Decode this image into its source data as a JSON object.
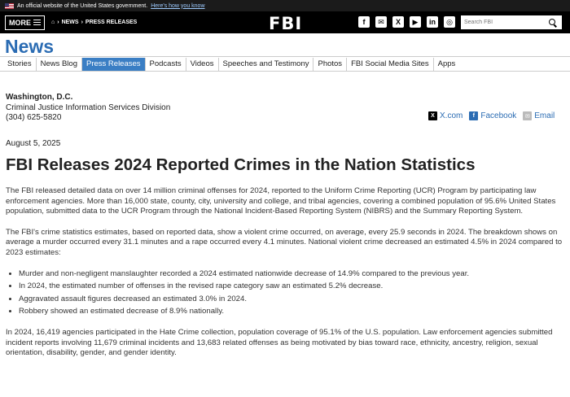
{
  "gov_banner": {
    "text": "An official website of the United States government.",
    "link": "Here's how you know"
  },
  "header": {
    "more_label": "MORE",
    "breadcrumb": [
      "NEWS",
      "PRESS RELEASES"
    ],
    "logo": "FBI",
    "social_icons": [
      "facebook-icon",
      "email-icon",
      "x-icon",
      "youtube-icon",
      "linkedin-icon",
      "instagram-icon"
    ],
    "search_placeholder": "Search FBI"
  },
  "section_title": "News",
  "subnav": [
    "Stories",
    "News Blog",
    "Press Releases",
    "Podcasts",
    "Videos",
    "Speeches and Testimony",
    "Photos",
    "FBI Social Media Sites",
    "Apps"
  ],
  "active_subnav": "Press Releases",
  "contact": {
    "city": "Washington, D.C.",
    "division": "Criminal Justice Information Services Division",
    "phone": "(304) 625-5820"
  },
  "share": {
    "x": "X.com",
    "facebook": "Facebook",
    "email": "Email"
  },
  "article": {
    "date": "August 5, 2025",
    "title": "FBI Releases 2024 Reported Crimes in the Nation Statistics",
    "p1": "The FBI released detailed data on over 14 million criminal offenses for 2024, reported to the Uniform Crime Reporting (UCR) Program by participating law enforcement agencies. More than 16,000 state, county, city, university and college, and tribal agencies, covering a combined population of 95.6% United States population, submitted data to the UCR Program through the National Incident-Based Reporting System (NIBRS) and the Summary Reporting System.",
    "p2": "The FBI's crime statistics estimates, based on reported data, show a violent crime occurred, on average, every 25.9 seconds in 2024. The breakdown shows on average a murder occurred every 31.1 minutes and a rape occurred every 4.1 minutes. National violent crime decreased an estimated 4.5% in 2024 compared to 2023 estimates:",
    "bullets": [
      "Murder and non-negligent manslaughter recorded a 2024 estimated nationwide decrease of 14.9% compared to the previous year.",
      "In 2024, the estimated number of offenses in the revised rape category saw an estimated 5.2% decrease.",
      "Aggravated assault figures decreased an estimated 3.0% in 2024.",
      "Robbery showed an estimated decrease of 8.9% nationally."
    ],
    "p3": "In 2024, 16,419 agencies participated in the Hate Crime collection, population coverage of 95.1% of the U.S. population. Law enforcement agencies submitted incident reports involving 11,679 criminal incidents and 13,683 related offenses as being motivated by bias toward race, ethnicity, ancestry, religion, sexual orientation, disability, gender, and gender identity."
  }
}
